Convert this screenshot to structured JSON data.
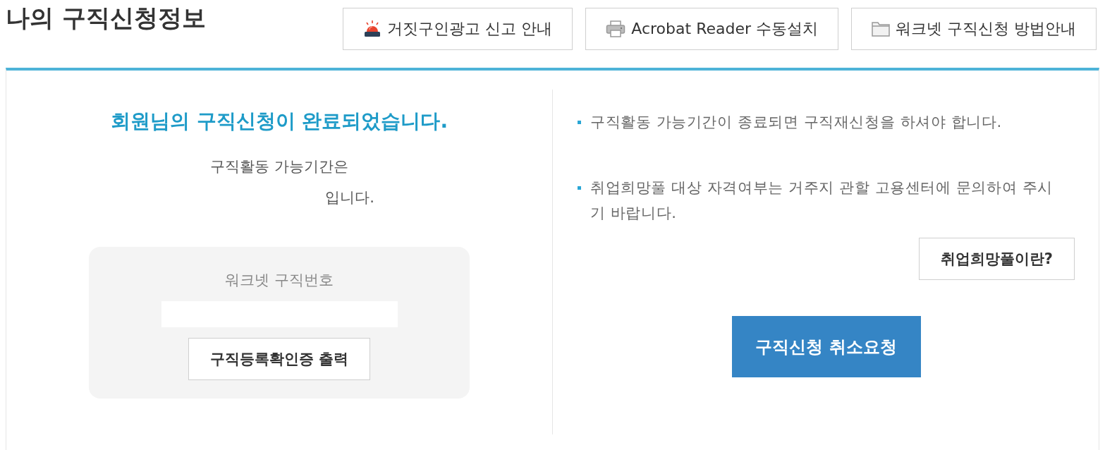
{
  "page": {
    "title": "나의 구직신청정보"
  },
  "header_buttons": [
    {
      "kind": "siren",
      "label": "거짓구인광고 신고 안내"
    },
    {
      "kind": "printer",
      "label": "Acrobat Reader 수동설치"
    },
    {
      "kind": "folder",
      "label": "워크넷 구직신청 방법안내"
    }
  ],
  "status": {
    "heading": "회원님의 구직신청이 완료되었습니다.",
    "period_label": "구직활동 가능기간은",
    "period_suffix": "입니다.",
    "card": {
      "label": "워크넷 구직번호",
      "button": "구직등록확인증 출력"
    }
  },
  "notices": {
    "items": [
      "구직활동 가능기간이 종료되면 구직재신청을 하셔야 합니다.",
      "취업희망풀 대상 자격여부는 거주지 관할 고용센터에 문의하여 주시기 바랍니다."
    ],
    "button": "취업희망풀이란?"
  },
  "cancel_button": "구직신청 취소요청"
}
